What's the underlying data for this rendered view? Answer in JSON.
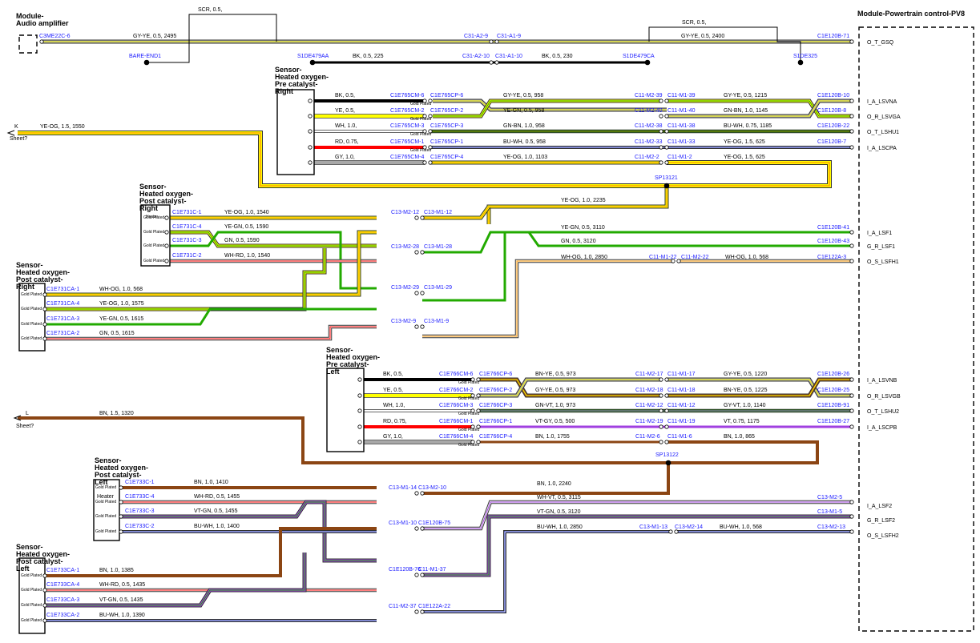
{
  "colors": {
    "BK": "#000000",
    "YE": "#ffff00",
    "WH": "#ffffff",
    "RD": "#ff0000",
    "GY": "#a8a8a8",
    "OG": "#ff9900",
    "GN": "#22aa00",
    "BN": "#8b4513",
    "BU": "#0010a0",
    "VT": "#a040e0",
    "connector": "#1a1aff"
  },
  "components": {
    "audio": "Module-Audio amplifier",
    "pcm": "Module-Powertrain control-PV8",
    "s_pre_right": "Sensor-Heated oxygen-Pre catalyst-Right",
    "s_post_right_a": "Sensor-Heated oxygen-Post catalyst-Right",
    "s_post_right_b": "Sensor-Heated oxygen-Post catalyst-Right",
    "s_pre_left": "Sensor-Heated oxygen-Pre catalyst-Left",
    "s_post_left_a": "Sensor-Heated oxygen-Post catalyst-Left",
    "s_post_left_b": "Sensor-Heated oxygen-Post catalyst-Left"
  },
  "text": {
    "scr1": "SCR, 0.5,",
    "scr2": "SCR, 0.5,",
    "bare_end": "BARE-END1",
    "s1de325": "S1DE325",
    "sheet_k": "K",
    "sheet_l": "L",
    "sheet_q1": "Sheet?",
    "sheet_q2": "Sheet?",
    "gold": "Gold Plated",
    "heater_a": "Heater",
    "heater_b": "Heater",
    "splice1": "SP13121",
    "splice2": "SP13122"
  },
  "pcm_pins": [
    "O_T_GSQ",
    "I_A_LSVNA",
    "O_R_LSVGA",
    "O_T_LSHU1",
    "I_A_LSCPA",
    "I_A_LSF1",
    "G_R_LSF1",
    "O_S_LSFH1",
    "I_A_LSVNB",
    "O_R_LSVGB",
    "O_T_LSHU2",
    "I_A_LSCPB",
    "I_A_LSF2",
    "G_R_LSF2",
    "O_S_LSFH2"
  ],
  "wire_labels": [
    "GY-YE, 0.5, 2495",
    "BK, 0.5, 225",
    "BK, 0.5, 230",
    "GY-YE, 0.5, 2400",
    "BK, 0.5,",
    "YE, 0.5,",
    "WH, 1.0,",
    "RD, 0.75,",
    "GY, 1.0,",
    "GY-YE, 0.5, 958",
    "YE-GN, 0.5, 958",
    "GN-BN, 1.0, 958",
    "BU-WH, 0.5, 958",
    "YE-OG, 1.0, 1103",
    "YE-GN, 0.5, 1220",
    "GY-YE, 0.5, 1215",
    "GN-BN, 1.0, 1145",
    "BU-WH, 0.75, 1185",
    "YE-OG, 1.5, 625",
    "YE-OG, 1.5, 1550",
    "YE-OG, 1.0, 2235",
    "YE-OG, 1.0, 1540",
    "YE-GN, 0.5, 1590",
    "GN, 0.5, 1590",
    "WH-RD, 1.0, 1540",
    "YE-GN, 0.5, 3110",
    "GN, 0.5, 3120",
    "WH-OG, 1.0, 2850",
    "WH-OG, 1.0, 568",
    "YE-OG, 1.0, 1575",
    "YE-GN, 0.5, 1615",
    "GN, 0.5, 1615",
    "WH-RD, 1.0, 1560",
    "BK, 0.5,",
    "YE, 0.5,",
    "WH, 1.0,",
    "RD, 0.75,",
    "GY, 1.0,",
    "BN-YE, 0.5, 973",
    "GY-YE, 0.5, 973",
    "GN-VT, 1.0, 973",
    "VT-GY, 0.5, 500",
    "BN, 1.0, 1755",
    "GY-YE, 0.5, 1220",
    "BN-YE, 0.5, 1225",
    "GY-VT, 1.0, 1140",
    "VT, 0.75, 1175",
    "BN, 1.0, 865",
    "BN, 1.5, 1320",
    "BN, 1.0, 2240",
    "BN, 1.0, 1410",
    "WH-RD, 0.5, 1455",
    "VT-GN, 0.5, 1455",
    "BU-WH, 1.0, 1400",
    "WH-VT, 0.5, 3115",
    "VT-GN, 0.5, 3120",
    "BU-WH, 1.0, 2850",
    "BU-WH, 1.0, 568",
    "BN, 1.0, 1385",
    "WH-RD, 0.5, 1435",
    "VT-GN, 0.5, 1435",
    "BU-WH, 1.0, 1390"
  ],
  "connector_labels": [
    "C3ME22C-6",
    "S1DE479AA",
    "C31-A2-9",
    "C31-A1-9",
    "C31-A2-10",
    "C31-A1-10",
    "S1DE479CA",
    "C1E120B-71",
    "C1E765CM-6",
    "C1E765CP-6",
    "C1E765CM-2",
    "C1E765CP-2",
    "C1E765CM-3",
    "C1E765CP-3",
    "C1E765CM-1",
    "C1E765CP-1",
    "C1E765CM-4",
    "C1E765CP-4",
    "C11-M2-39",
    "C11-M1-39",
    "C11-M2-40",
    "C11-M1-40",
    "C11-M2-38",
    "C11-M1-38",
    "C11-M2-33",
    "C11-M1-33",
    "C11-M2-2",
    "C11-M1-2",
    "C1E120B-10",
    "C1E120B-8",
    "C1E120B-22",
    "C1E120B-7",
    "C1E731C-1",
    "C1E731C-4",
    "C1E731C-3",
    "C1E731C-2",
    "C13-M2-12",
    "C13-M1-12",
    "C13-M2-28",
    "C13-M1-28",
    "C13-M2-29",
    "C13-M1-29",
    "C13-M2-9",
    "C13-M1-9",
    "C1E120B-41",
    "C1E120B-43",
    "C11-M1-22",
    "C11-M2-22",
    "C1E122A-3",
    "C1E731CA-1",
    "C1E731CA-4",
    "C1E731CA-3",
    "C1E731CA-2",
    "C1E766CM-6",
    "C1E766CP-6",
    "C1E766CM-2",
    "C1E766CP-2",
    "C1E766CM-3",
    "C1E766CP-3",
    "C1E766CM-1",
    "C1E766CP-1",
    "C1E766CM-4",
    "C1E766CP-4",
    "C11-M2-17",
    "C11-M1-17",
    "C11-M2-18",
    "C11-M1-18",
    "C11-M2-12",
    "C11-M1-12",
    "C11-M2-19",
    "C11-M1-19",
    "C11-M2-6",
    "C11-M1-6",
    "C1E120B-26",
    "C1E120B-25",
    "C1E120B-91",
    "C1E120B-27",
    "C1E733C-1",
    "C1E733C-4",
    "C1E733C-3",
    "C1E733C-2",
    "C13-M2-5",
    "C13-M1-5",
    "C13-M2-13",
    "C13-M1-13",
    "C13-M2-14",
    "C13-M1-14",
    "C13-M2-10",
    "C13-M1-10",
    "C1E120B-75",
    "C1E120B-76",
    "C11-M1-37",
    "C11-M2-37",
    "C1E122A-22",
    "C1E733CA-1",
    "C1E733CA-4",
    "C1E733CA-3",
    "C1E733CA-2"
  ]
}
